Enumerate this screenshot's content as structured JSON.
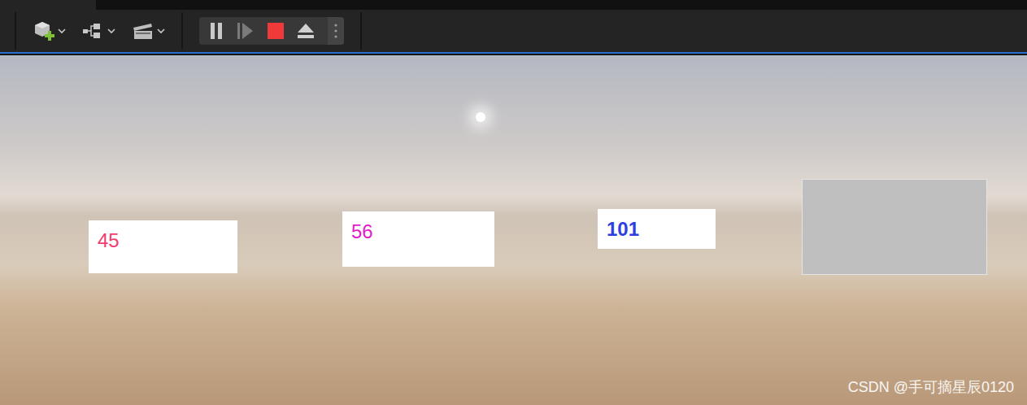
{
  "editor": {
    "toolbar": {
      "play_controls": {
        "paused": false
      }
    }
  },
  "viewport": {
    "widgets": [
      {
        "kind": "number",
        "text": "45",
        "color": "#f03c6e",
        "bold": false
      },
      {
        "kind": "number",
        "text": "56",
        "color": "#e21cc6",
        "bold": false
      },
      {
        "kind": "number",
        "text": "101",
        "color": "#2f3fe0",
        "bold": true
      },
      {
        "kind": "blank",
        "text": "",
        "color": "#bfbfbf",
        "bold": false
      }
    ]
  },
  "watermark": "CSDN @手可摘星辰0120"
}
